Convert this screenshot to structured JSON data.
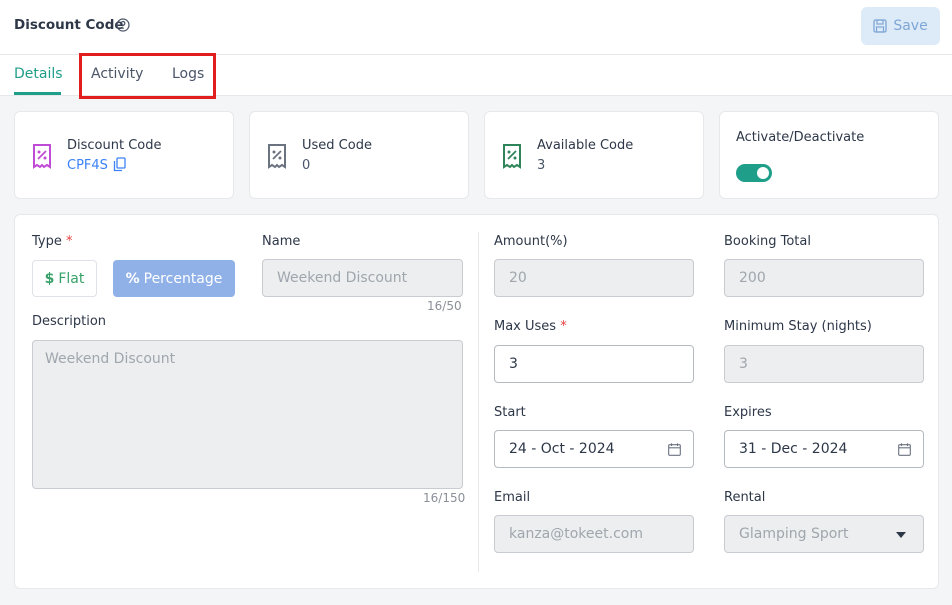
{
  "header": {
    "title": "Discount Code",
    "save_label": "Save"
  },
  "tabs": [
    {
      "label": "Details",
      "active": true
    },
    {
      "label": "Activity",
      "active": false
    },
    {
      "label": "Logs",
      "active": false
    }
  ],
  "stats": {
    "discount_code": {
      "label": "Discount Code",
      "value": "CPF4S"
    },
    "used_code": {
      "label": "Used Code",
      "value": "0"
    },
    "available_code": {
      "label": "Available Code",
      "value": "3"
    },
    "activate": {
      "label": "Activate/Deactivate",
      "enabled": true
    }
  },
  "form": {
    "type_label": "Type",
    "flat_label": "Flat",
    "percentage_label": "Percentage",
    "selected_type": "Percentage",
    "name_label": "Name",
    "name_value": "Weekend Discount",
    "name_counter": "16/50",
    "description_label": "Description",
    "description_value": "Weekend Discount",
    "description_counter": "16/150",
    "amount_label": "Amount(%)",
    "amount_value": "20",
    "booking_total_label": "Booking Total",
    "booking_total_value": "200",
    "max_uses_label": "Max Uses",
    "max_uses_value": "3",
    "min_stay_label": "Minimum Stay (nights)",
    "min_stay_value": "3",
    "start_label": "Start",
    "start_value": "24 - Oct - 2024",
    "expires_label": "Expires",
    "expires_value": "31 - Dec - 2024",
    "email_label": "Email",
    "email_value": "kanza@tokeet.com",
    "rental_label": "Rental",
    "rental_value": "Glamping Sport",
    "required_mark": "*"
  },
  "colors": {
    "accent": "#1f9e8a",
    "link": "#3b82f6",
    "highlight": "#e11d1d",
    "discount_icon": "#c04bd6",
    "used_icon": "#6b7280",
    "available_icon": "#2f855a"
  }
}
